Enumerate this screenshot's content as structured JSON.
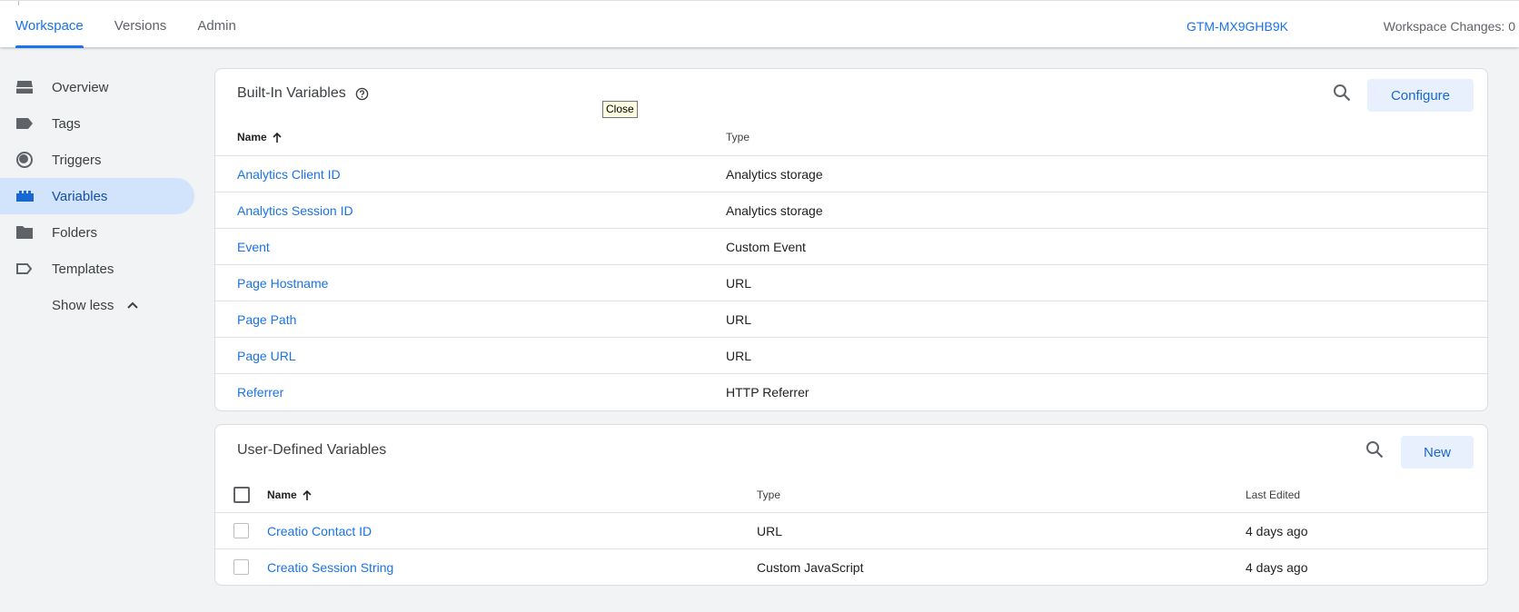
{
  "topbar": {
    "tabs": [
      {
        "label": "Workspace",
        "active": true
      },
      {
        "label": "Versions",
        "active": false
      },
      {
        "label": "Admin",
        "active": false
      }
    ],
    "container_id": "GTM-MX9GHB9K",
    "workspace_changes": "Workspace Changes: 0"
  },
  "sidebar": {
    "items": [
      {
        "label": "Overview",
        "icon": "briefcase-icon"
      },
      {
        "label": "Tags",
        "icon": "tag-icon"
      },
      {
        "label": "Triggers",
        "icon": "trigger-icon"
      },
      {
        "label": "Variables",
        "icon": "variables-icon",
        "active": true
      },
      {
        "label": "Folders",
        "icon": "folder-icon"
      },
      {
        "label": "Templates",
        "icon": "template-icon"
      }
    ],
    "show_less": "Show less"
  },
  "builtin": {
    "title": "Built-In Variables",
    "configure": "Configure",
    "col_name": "Name",
    "col_type": "Type",
    "rows": [
      {
        "name": "Analytics Client ID",
        "type": "Analytics storage"
      },
      {
        "name": "Analytics Session ID",
        "type": "Analytics storage"
      },
      {
        "name": "Event",
        "type": "Custom Event"
      },
      {
        "name": "Page Hostname",
        "type": "URL"
      },
      {
        "name": "Page Path",
        "type": "URL"
      },
      {
        "name": "Page URL",
        "type": "URL"
      },
      {
        "name": "Referrer",
        "type": "HTTP Referrer"
      }
    ]
  },
  "userdefined": {
    "title": "User-Defined Variables",
    "new": "New",
    "col_name": "Name",
    "col_type": "Type",
    "col_edited": "Last Edited",
    "rows": [
      {
        "name": "Creatio Contact ID",
        "type": "URL",
        "edited": "4 days ago"
      },
      {
        "name": "Creatio Session String",
        "type": "Custom JavaScript",
        "edited": "4 days ago"
      }
    ]
  },
  "tooltip": "Close",
  "colors": {
    "accent": "#1a73e8",
    "active_nav_bg": "#d2e3fc",
    "button_bg": "#e8f0fe"
  }
}
